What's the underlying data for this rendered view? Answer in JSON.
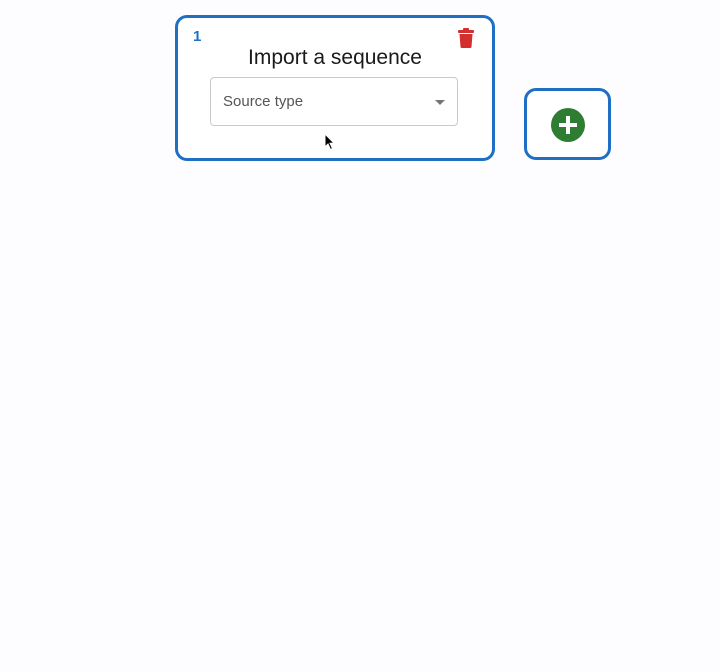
{
  "source_card": {
    "step_number": "1",
    "title": "Import a sequence",
    "source_select": {
      "placeholder": "Source type"
    }
  },
  "icons": {
    "delete": "trash-icon",
    "add": "plus-circle-icon",
    "cursor": "mouse-pointer"
  },
  "colors": {
    "card_border": "#1f6fc5",
    "delete": "#d32f2f",
    "add": "#2e7d32"
  }
}
